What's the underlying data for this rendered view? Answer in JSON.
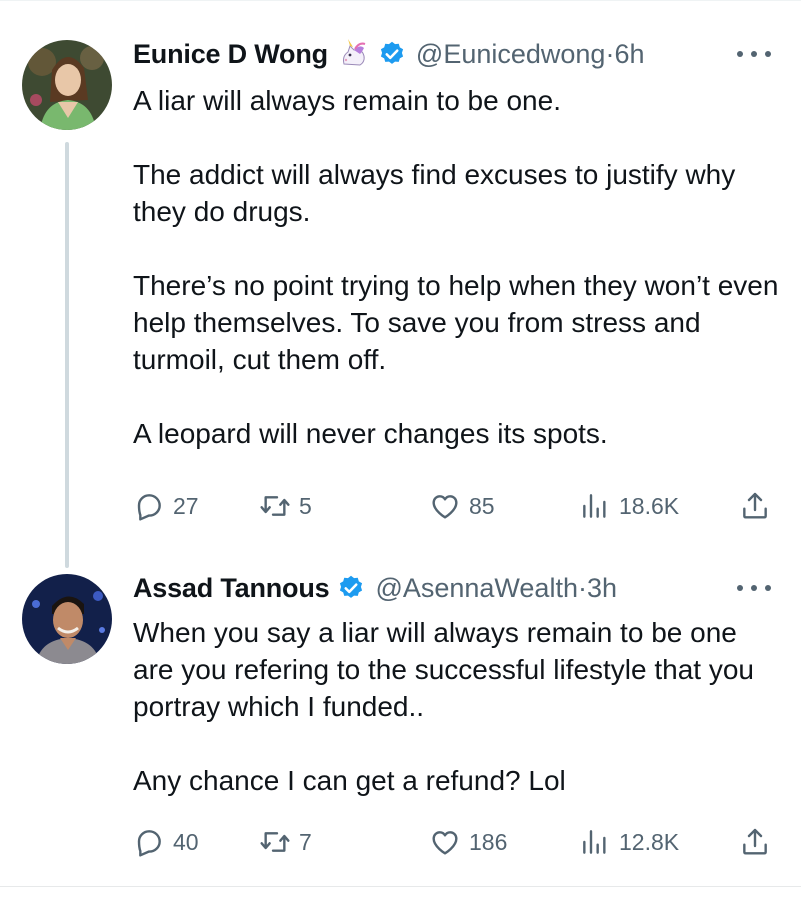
{
  "tweets": [
    {
      "author": {
        "name": "Eunice D Wong",
        "emoji_icon": "unicorn-icon",
        "verified": true,
        "handle": "@Eunicedwong",
        "time": "6h"
      },
      "text": "A liar will always remain to be one.\n\nThe addict will always find excuses to justify why they do drugs.\n\nThere’s no point trying to help when they won’t even help themselves. To save you from stress and turmoil, cut them off.\n\nA leopard will never changes its spots.",
      "stats": {
        "replies": "27",
        "retweets": "5",
        "likes": "85",
        "views": "18.6K"
      }
    },
    {
      "author": {
        "name": "Assad Tannous",
        "verified": true,
        "handle": "@AsennaWealth",
        "time": "3h"
      },
      "text": "When you say a liar will always remain to be one are you refering to the successful lifestyle that you portray which I funded..\n\nAny chance I can get a refund? Lol",
      "stats": {
        "replies": "40",
        "retweets": "7",
        "likes": "186",
        "views": "12.8K"
      }
    }
  ],
  "ui": {
    "separator": "·",
    "colors": {
      "text": "#0f1419",
      "secondary": "#536471",
      "verified": "#1d9bf0",
      "thread_line": "#cfd9de"
    },
    "icons": [
      "reply-icon",
      "retweet-icon",
      "like-icon",
      "views-icon",
      "share-icon",
      "more-icon",
      "verified-badge-icon",
      "unicorn-icon"
    ]
  }
}
